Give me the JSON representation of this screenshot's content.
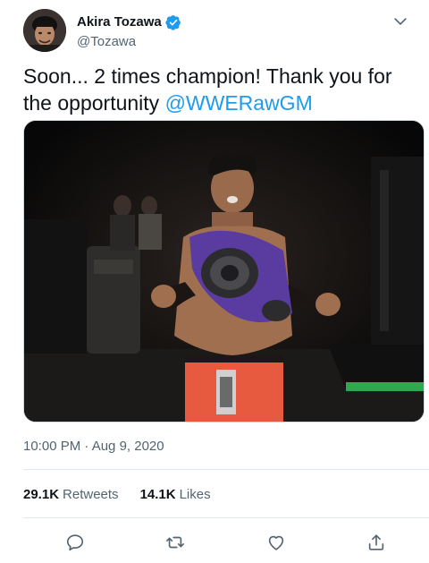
{
  "user": {
    "display_name": "Akira Tozawa",
    "handle": "@Tozawa",
    "verified": true
  },
  "tweet": {
    "text": "Soon... 2 times champion! Thank you for the opportunity ",
    "mention": "@WWERawGM"
  },
  "meta": {
    "timestamp": "10:00 PM · Aug 9, 2020"
  },
  "stats": {
    "retweets_count": "29.1K",
    "retweets_label": "Retweets",
    "likes_count": "14.1K",
    "likes_label": "Likes"
  },
  "icons": {
    "caret": "chevron-down-icon",
    "reply": "reply-icon",
    "retweet": "retweet-icon",
    "like": "heart-icon",
    "share": "share-icon"
  },
  "colors": {
    "accent": "#1d9bf0",
    "text": "#0f1419",
    "secondary": "#536471",
    "belt_purple": "#5a3ca0",
    "trunks_red": "#e85a40"
  }
}
